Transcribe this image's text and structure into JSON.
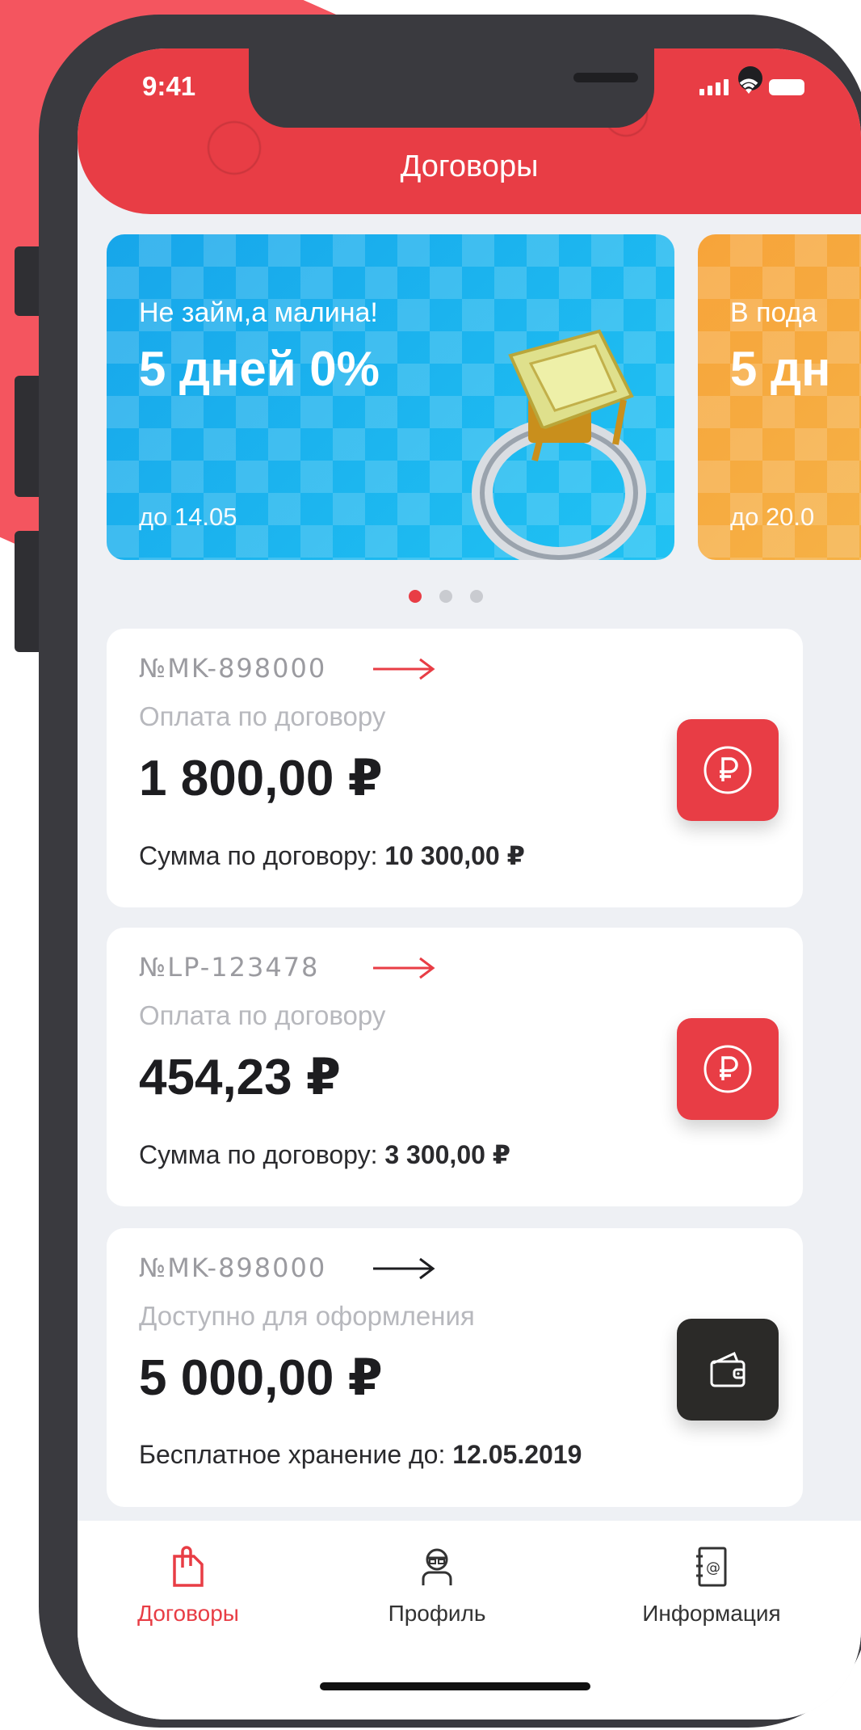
{
  "status": {
    "time": "9:41"
  },
  "header": {
    "title": "Договоры"
  },
  "banners": [
    {
      "subtitle": "Не займ,а малина!",
      "headline": "5 дней 0%",
      "until": "до 14.05"
    },
    {
      "subtitle": "В пода",
      "headline": "5 дн",
      "until": "до 20.0"
    }
  ],
  "carousel": {
    "active_index": 0,
    "count": 3
  },
  "contracts": [
    {
      "number": "№MK-898000",
      "label": "Оплата по договору",
      "amount": "1 800,00 ₽",
      "foot_label": "Сумма по договору: ",
      "foot_value": "10 300,00 ₽",
      "button_icon": "ruble-icon",
      "arrow_color": "#e83d45"
    },
    {
      "number": "№LP-123478",
      "label": "Оплата по договору",
      "amount": "454,23 ₽",
      "foot_label": "Сумма по договору: ",
      "foot_value": "3 300,00 ₽",
      "button_icon": "ruble-icon",
      "arrow_color": "#e83d45"
    },
    {
      "number": "№MK-898000",
      "label": "Доступно для оформления",
      "amount": "5 000,00 ₽",
      "foot_label": "Бесплатное хранение до: ",
      "foot_value": "12.05.2019",
      "button_icon": "wallet-icon",
      "arrow_color": "#1d1d20"
    }
  ],
  "tabbar": {
    "items": [
      {
        "label": "Договоры",
        "icon": "contracts-icon",
        "active": true
      },
      {
        "label": "Профиль",
        "icon": "profile-icon",
        "active": false
      },
      {
        "label": "Информация",
        "icon": "info-book-icon",
        "active": false
      }
    ]
  },
  "colors": {
    "accent": "#e83d45",
    "background": "#eef0f4",
    "dark_button": "#2b2a28"
  }
}
